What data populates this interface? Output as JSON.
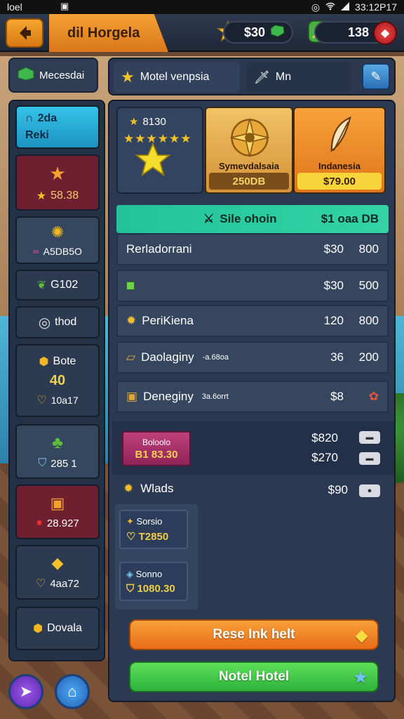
{
  "status_bar": {
    "left": "loel",
    "middle": "▣",
    "time": "33:12P17"
  },
  "top_bar": {
    "title": "dil Horgela",
    "currency_stars": "$30",
    "currency_gems": "138"
  },
  "sidebar": {
    "header": "Mecesdai",
    "items": [
      {
        "line1": "2da",
        "line2": "Reki"
      },
      {
        "line1": "",
        "line2": "58.38"
      },
      {
        "line1": "",
        "line2": "A5DB5O"
      },
      {
        "line1": "G102",
        "line2": ""
      },
      {
        "line1": "thod",
        "line2": ""
      },
      {
        "line1": "Bote",
        "line2": "",
        "extra1": "40",
        "extra2": "10a17"
      },
      {
        "line1": "",
        "line2": "285 1"
      },
      {
        "line1": "",
        "line2": "28.927"
      },
      {
        "line1": "",
        "line2": "4aa72"
      },
      {
        "line1": "Dovala",
        "line2": ""
      }
    ]
  },
  "main_header": {
    "tab1": "Motel venpsia",
    "tab2": "Mn"
  },
  "promo_cards": {
    "star_card_title": "8130",
    "gold_card_label": "Symevdalsaia",
    "gold_card_price": "250DB",
    "orange_card_label": "Indanesia",
    "orange_card_price": "$79.00"
  },
  "sale_bar": {
    "label": "Sile ohoin",
    "value": "$1 oaa DB"
  },
  "rows": [
    {
      "label": "Rerladorrani",
      "sub": "",
      "v1": "$30",
      "v2": "800"
    },
    {
      "label": "",
      "sub": "",
      "v1": "$30",
      "v2": "500"
    },
    {
      "label": "PeriKiena",
      "sub": "",
      "v1": "120",
      "v2": "800"
    },
    {
      "label": "Daolaginy",
      "sub": "-a.68oa",
      "v1": "36",
      "v2": "200"
    },
    {
      "label": "Deneginy",
      "sub": "3a.6orrt",
      "v1": "$8",
      "v2": ""
    }
  ],
  "promo_block": {
    "chip_line1": "Boloolo",
    "chip_line2": "B1 83.30",
    "price1": "$820",
    "price2": "$270"
  },
  "wlads": {
    "label": "Wlads",
    "price": "$90",
    "card1_title": "Sorsio",
    "card1_value": "T2850",
    "card2_title": "Sonno",
    "card2_value": "1080.30"
  },
  "buttons": {
    "orange": "Rese Ink helt",
    "green": "Notel Hotel"
  }
}
